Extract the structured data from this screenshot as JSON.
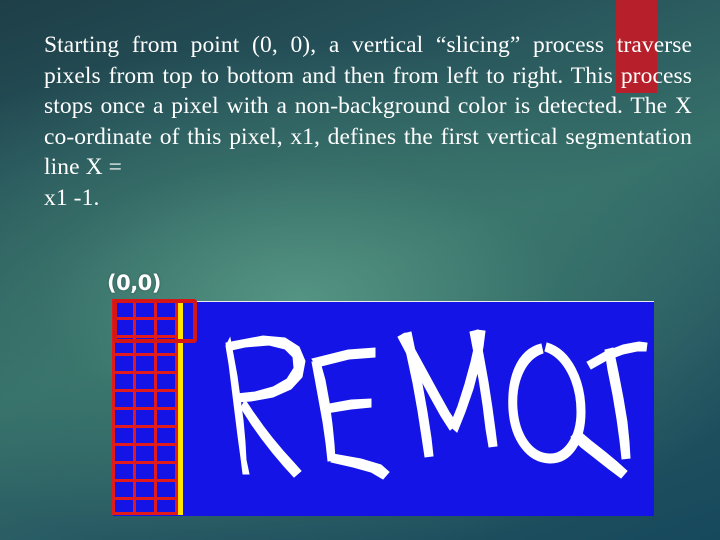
{
  "slide": {
    "background_dark": "#1e3f47",
    "background_mid": "#36706a",
    "accent_bar_color": "#b7202a"
  },
  "body": {
    "paragraph": "Starting from point (0, 0), a vertical “slicing” process traverse pixels from top to bottom and then from left to right. This process stops once a pixel with a non-background color is detected. The X co-ordinate of this pixel, x1, defines the first vertical segmentation line X =",
    "last_line": "x1 -1."
  },
  "figure": {
    "origin_label": "(0,0)",
    "word_in_image": "REMOTE",
    "image_background_color": "#1414e6",
    "ink_color": "#ffffff",
    "grid_color": "#e11b1b",
    "segmentation_line_color": "#ffe500",
    "highlight_box_color": "#d41616",
    "grid_columns": 3,
    "grid_rows": 12
  }
}
